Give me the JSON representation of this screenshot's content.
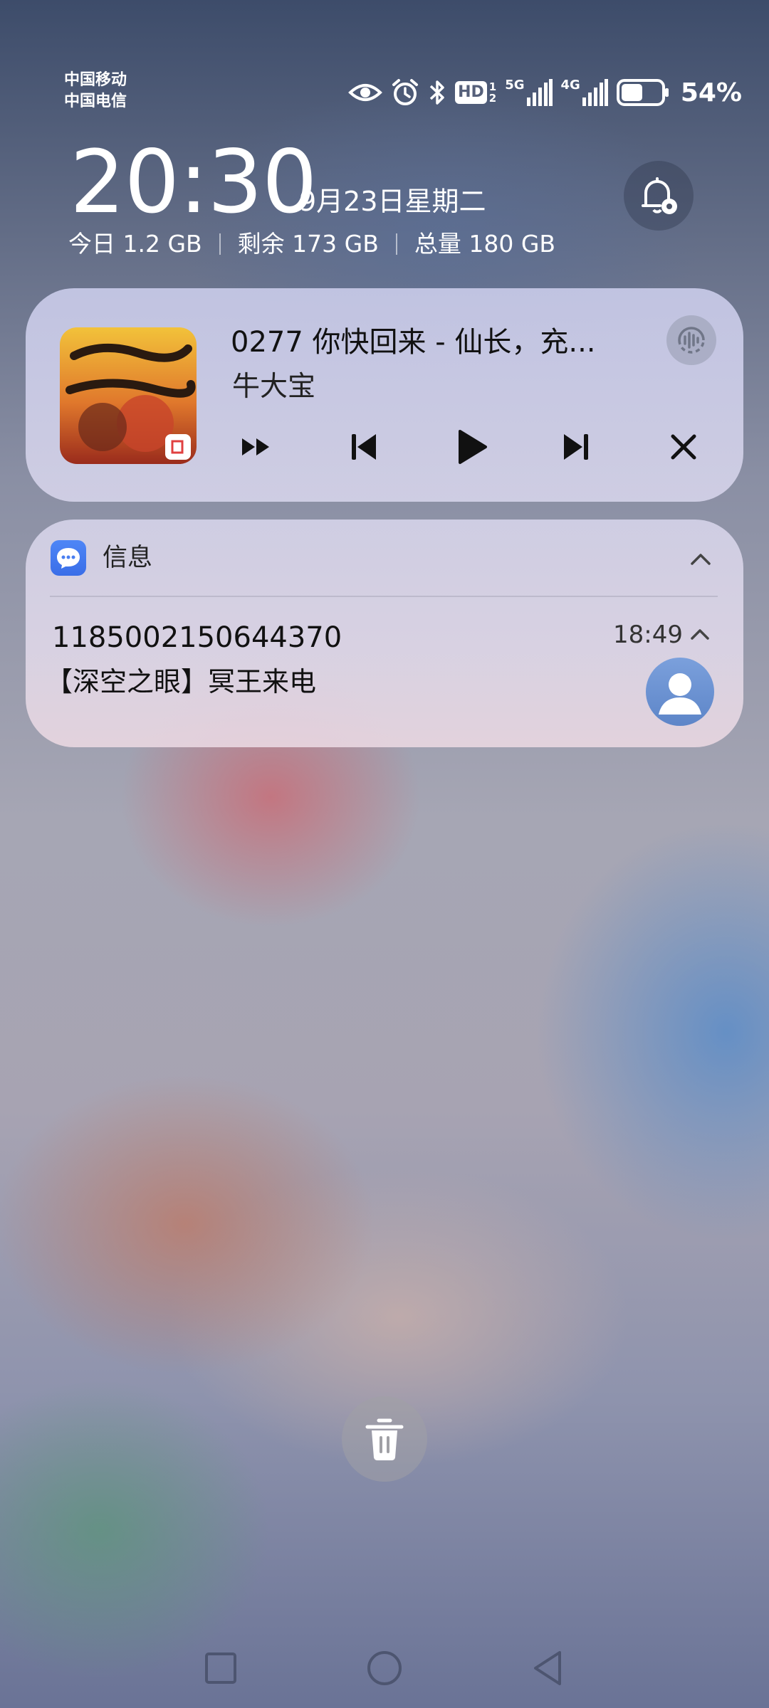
{
  "status_bar": {
    "carrier_1": "中国移动",
    "carrier_2": "中国电信",
    "hd_label": "HD",
    "hd_sub_1": "1",
    "hd_sub_2": "2",
    "net_1": "5G",
    "net_2": "4G",
    "battery_percent": "54%",
    "battery_level": 0.54,
    "icons": [
      "eye-comfort-icon",
      "alarm-icon",
      "bluetooth-icon",
      "hd-volte-icon",
      "signal-5g-icon",
      "signal-4g-icon",
      "battery-icon"
    ]
  },
  "header": {
    "time": "20:30",
    "date": "9月23日星期二",
    "storage": {
      "today": "今日 1.2 GB",
      "remaining": "剩余 173 GB",
      "total": "总量 180 GB"
    },
    "notification_settings_icon": "bell-settings-icon"
  },
  "media": {
    "title": "0277 你快回来 - 仙长，充...",
    "artist": "牛大宝",
    "cover_icon": "album-cover",
    "controls": [
      "speed-icon",
      "previous-icon",
      "play-icon",
      "next-icon",
      "close-icon"
    ],
    "audio_effect_icon": "audio-effect-icon"
  },
  "notification": {
    "app_name": "信息",
    "sender": "1185002150644370",
    "time": "18:49",
    "body": "【深空之眼】冥王来电"
  },
  "colors": {
    "messages_app_blue": "#4a7ff0",
    "avatar_blue": "#6b93d4"
  },
  "nav": [
    "recent-apps-icon",
    "home-icon",
    "back-icon"
  ]
}
